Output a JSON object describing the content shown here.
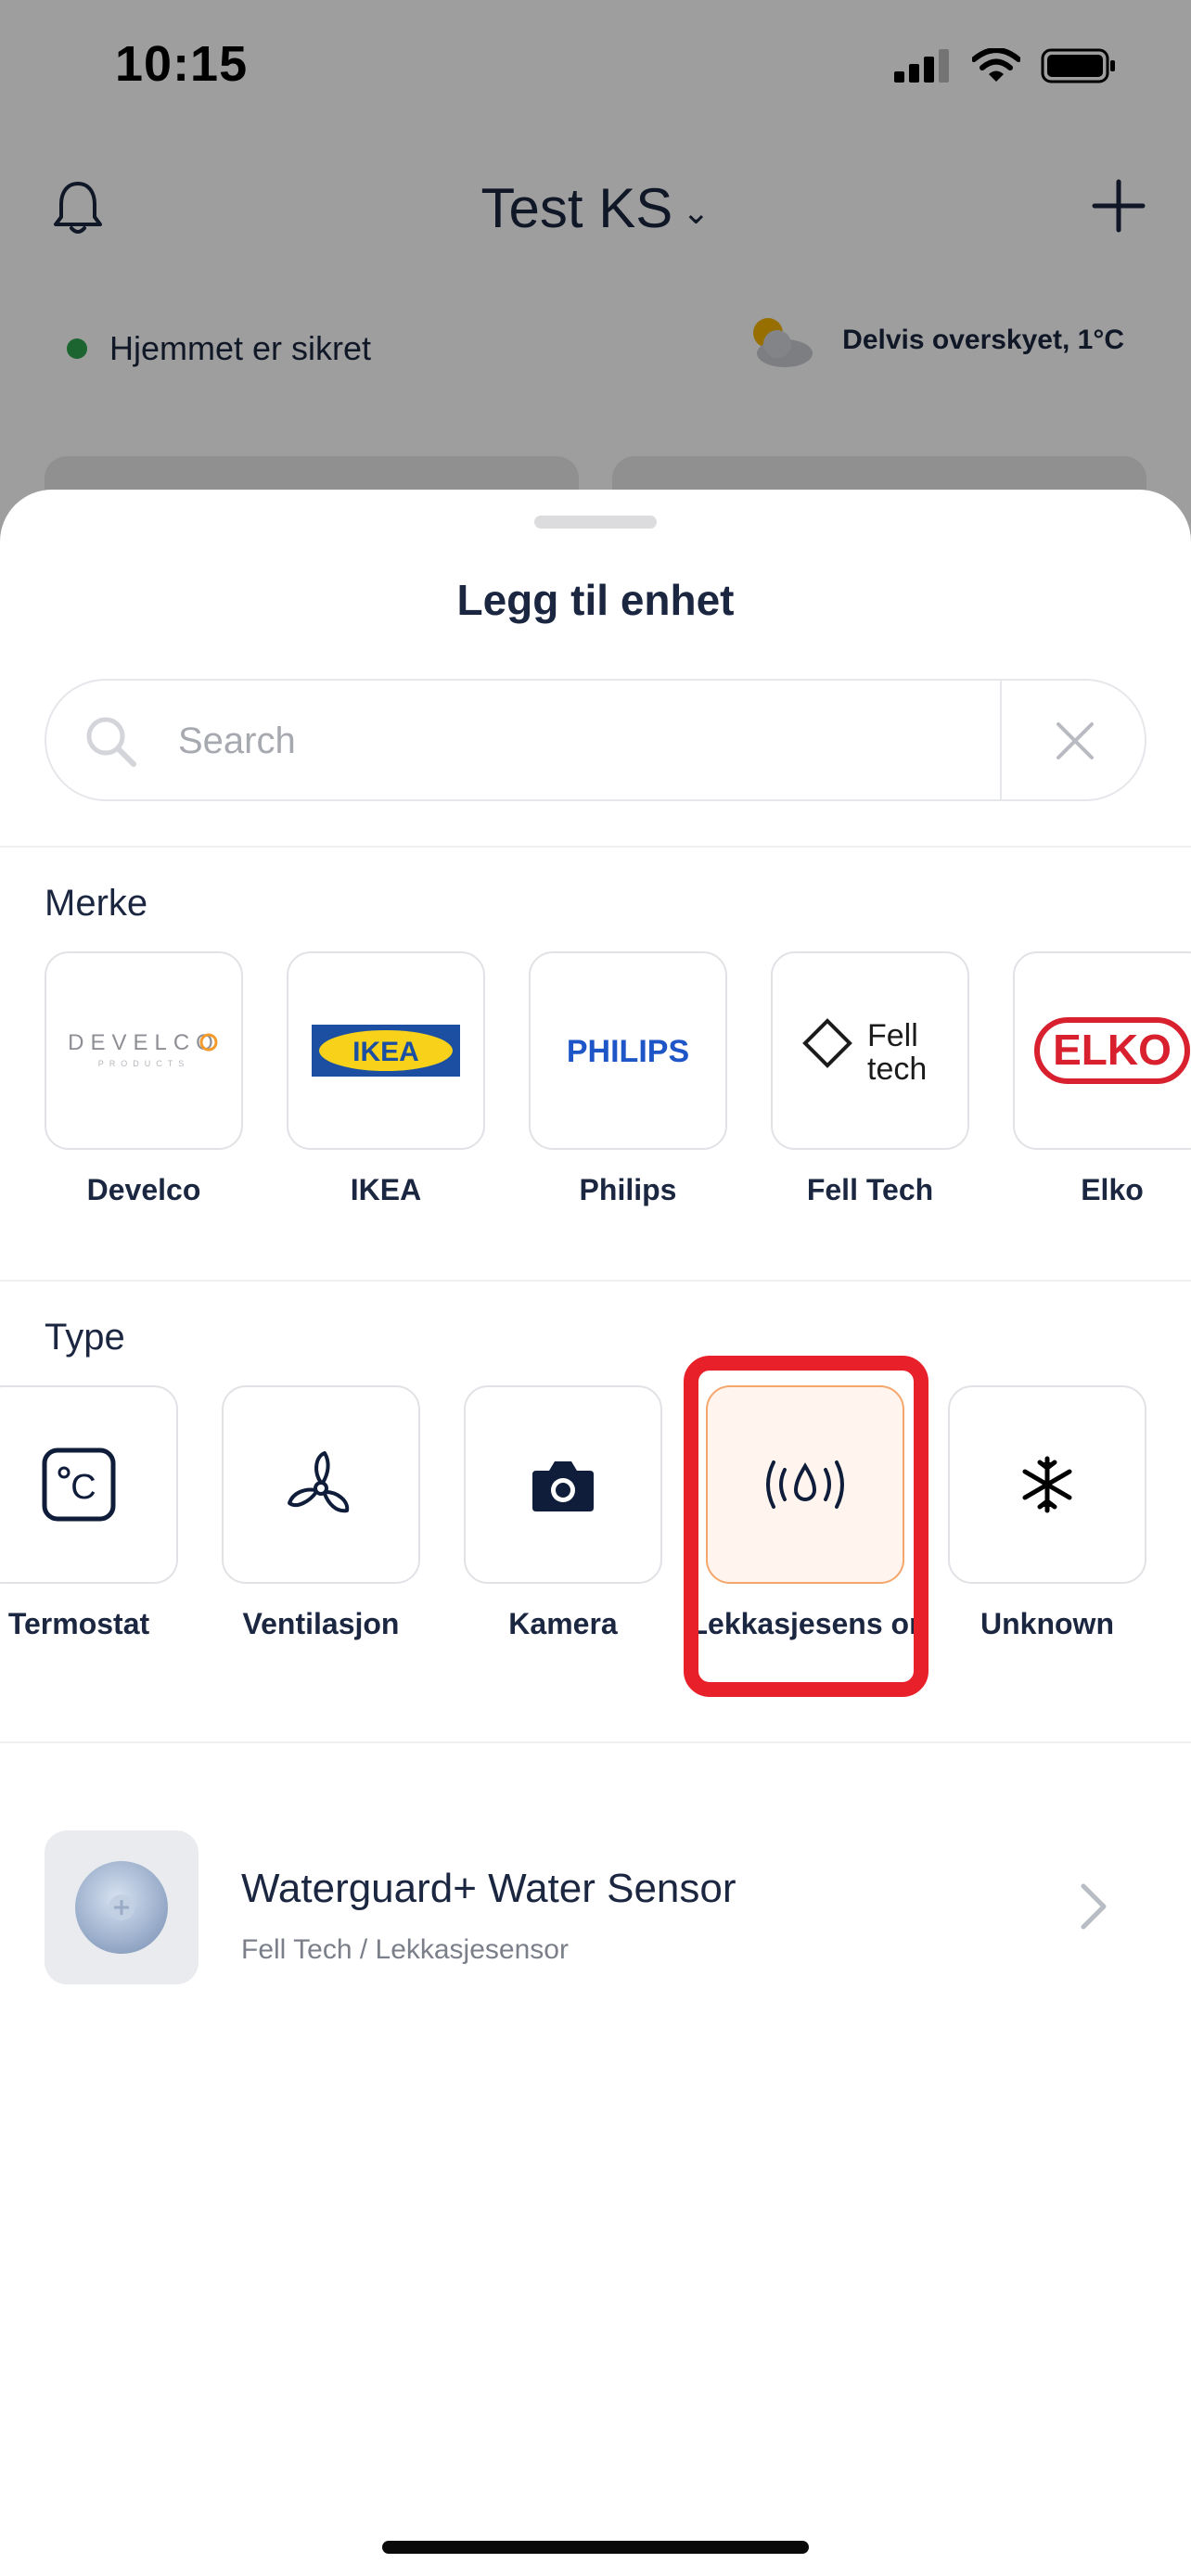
{
  "status_bar": {
    "time": "10:15"
  },
  "app": {
    "home_title": "Test KS",
    "security_status": "Hjemmet er sikret",
    "weather": "Delvis overskyet, 1°C"
  },
  "sheet": {
    "title": "Legg til enhet",
    "search": {
      "placeholder": "Search",
      "value": ""
    },
    "brand_section": {
      "label": "Merke",
      "items": [
        {
          "label": "Develco",
          "logo": "develco-logo"
        },
        {
          "label": "IKEA",
          "logo": "ikea-logo"
        },
        {
          "label": "Philips",
          "logo": "philips-logo"
        },
        {
          "label": "Fell Tech",
          "logo": "fell-tech-logo"
        },
        {
          "label": "Elko",
          "logo": "elko-logo"
        }
      ]
    },
    "type_section": {
      "label": "Type",
      "items": [
        {
          "label": "Termostat",
          "icon": "thermostat-icon"
        },
        {
          "label": "Ventilasjon",
          "icon": "fan-icon"
        },
        {
          "label": "Kamera",
          "icon": "camera-icon"
        },
        {
          "label": "Lekkasjesens or",
          "icon": "leak-sensor-icon",
          "selected": true
        },
        {
          "label": "Unknown",
          "icon": "snowflake-icon"
        }
      ]
    },
    "results": [
      {
        "title": "Waterguard+ Water Sensor",
        "subtitle": "Fell Tech / Lekkasjesensor"
      }
    ]
  },
  "logos": {
    "develco": {
      "word": "DEVELCO",
      "sub": "PRODUCTS"
    },
    "ikea": "IKEA",
    "philips": "PHILIPS",
    "fell_tech": {
      "line1": "Fell",
      "line2": "tech"
    },
    "elko": "ELKO"
  },
  "colors": {
    "accent_selected_bg": "#fff5ee",
    "accent_selected_border": "#f4a66b",
    "highlight": "#e8202a",
    "text_primary": "#1b2640",
    "status_ok": "#2ea44f"
  }
}
